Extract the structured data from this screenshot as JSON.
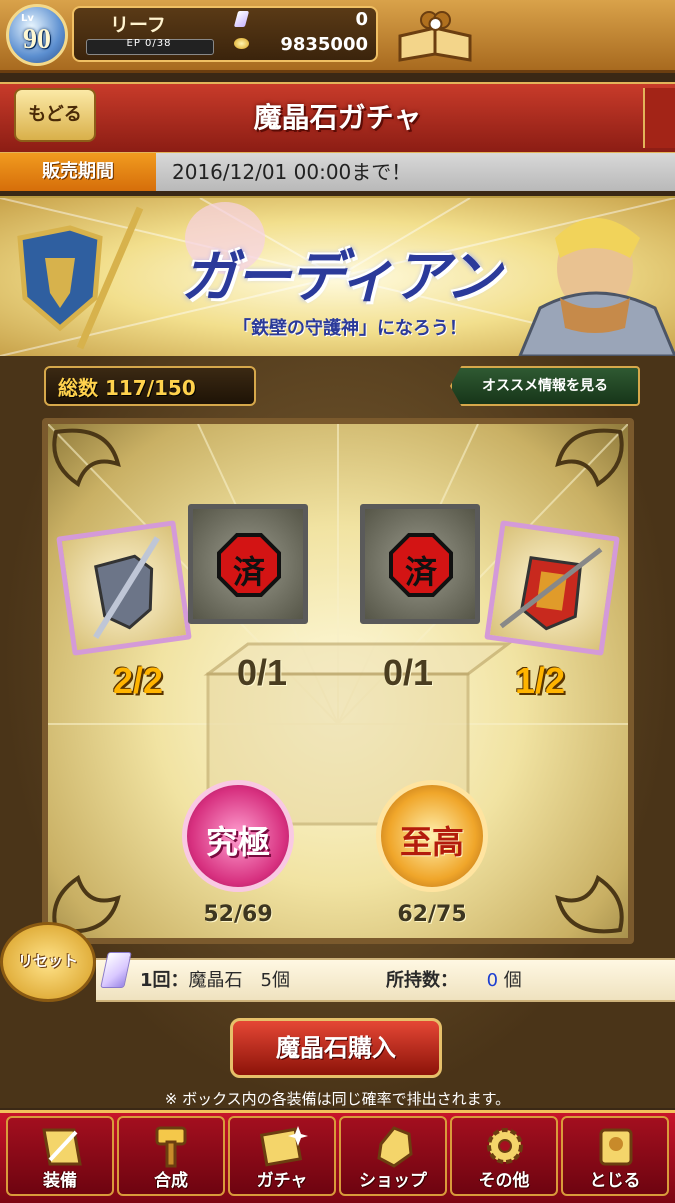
{
  "player": {
    "level_prefix": "Lv",
    "level": "90",
    "name": "リーフ",
    "ep_label": "EP 0/38",
    "crystals": "0",
    "gold": "9835000"
  },
  "header": {
    "back_label": "もどる",
    "title": "魔晶石ガチャ"
  },
  "sale": {
    "label": "販売期間",
    "text": "2016/12/01 00:00まで！"
  },
  "banner": {
    "title": "ガーディアン",
    "subtitle": "「鉄壁の守護神」になろう！"
  },
  "box": {
    "total_label": "総数 117/150",
    "recommend_label": "オススメ情報を見る",
    "items": [
      {
        "count": "2/2",
        "stamp": ""
      },
      {
        "count": "0/1",
        "stamp": "済"
      },
      {
        "count": "0/1",
        "stamp": "済"
      },
      {
        "count": "1/2",
        "stamp": ""
      }
    ],
    "medals": [
      {
        "label": "究極",
        "ratio": "52/69",
        "color": "#e0489a"
      },
      {
        "label": "至高",
        "ratio": "62/75",
        "color": "#e6a12a"
      }
    ]
  },
  "cost": {
    "reset_label": "リセット",
    "per_draw": "1回：",
    "item": "魔晶石　5個",
    "own_label": "所持数：",
    "own_value": "0",
    "own_unit": "個"
  },
  "buy_label": "魔晶石購入",
  "note": "※ ボックス内の各装備は同じ確率で排出されます。",
  "nav": [
    {
      "label": "装備",
      "icon": "equipment-icon"
    },
    {
      "label": "合成",
      "icon": "hammer-icon"
    },
    {
      "label": "ガチャ",
      "icon": "gacha-icon"
    },
    {
      "label": "ショップ",
      "icon": "crystal-shop-icon"
    },
    {
      "label": "その他",
      "icon": "gear-icon"
    },
    {
      "label": "とじる",
      "icon": "close-icon"
    }
  ],
  "colors": {
    "accent": "#c8142a",
    "gold": "#ffb400",
    "owned_count": "#1d3fd1"
  }
}
